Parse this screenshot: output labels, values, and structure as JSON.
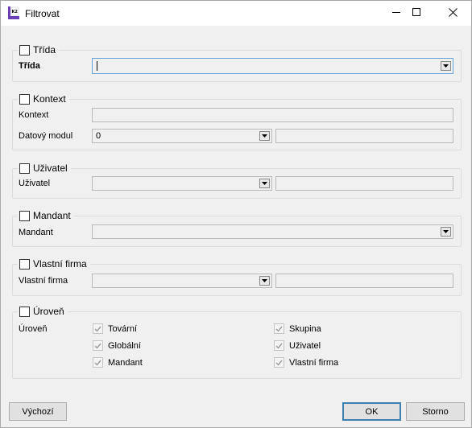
{
  "window": {
    "title": "Filtrovat",
    "app_icon": "k2-app-icon",
    "controls": [
      "minimize-icon",
      "maximize-icon",
      "close-icon"
    ]
  },
  "groups": {
    "trida": {
      "title": "Třída",
      "field_label": "Třída",
      "value": ""
    },
    "kontext": {
      "title": "Kontext",
      "kontext_label": "Kontext",
      "modul_label": "Datový modul",
      "modul_value": "0",
      "modul_text": ""
    },
    "uzivatel": {
      "title": "Uživatel",
      "field_label": "Uživatel",
      "value": "",
      "text": ""
    },
    "mandant": {
      "title": "Mandant",
      "field_label": "Mandant",
      "value": ""
    },
    "firma": {
      "title": "Vlastní firma",
      "field_label": "Vlastní firma",
      "value": "",
      "text": ""
    },
    "uroven": {
      "title": "Úroveň",
      "field_label": "Úroveň",
      "options": [
        {
          "label": "Tovární",
          "checked": true
        },
        {
          "label": "Globální",
          "checked": true
        },
        {
          "label": "Mandant",
          "checked": true
        },
        {
          "label": "Skupina",
          "checked": true
        },
        {
          "label": "Uživatel",
          "checked": true
        },
        {
          "label": "Vlastní firma",
          "checked": true
        }
      ]
    }
  },
  "buttons": {
    "default": "Výchozí",
    "ok": "OK",
    "cancel": "Storno"
  }
}
